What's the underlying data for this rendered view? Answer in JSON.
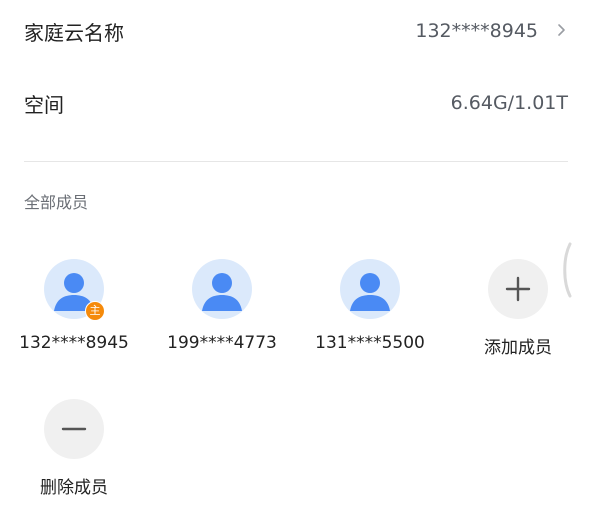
{
  "family_cloud": {
    "name_label": "家庭云名称",
    "name_value": "132****8945",
    "space_label": "空间",
    "space_value": "6.64G/1.01T"
  },
  "members_section": {
    "title": "全部成员",
    "owner_badge": "主",
    "members": [
      {
        "phone": "132****8945"
      },
      {
        "phone": "199****4773"
      },
      {
        "phone": "131****5500"
      }
    ],
    "add_label": "添加成员",
    "remove_label": "删除成员"
  },
  "icons": {
    "chevron": "chevron-right-icon",
    "avatar": "user-avatar-icon",
    "add": "plus-icon",
    "remove": "minus-icon"
  },
  "colors": {
    "avatar_bg": "#dbe9fb",
    "avatar_fg": "#4a8af4",
    "owner_badge": "#f58a0b",
    "action_bg": "#f0f0f0"
  }
}
